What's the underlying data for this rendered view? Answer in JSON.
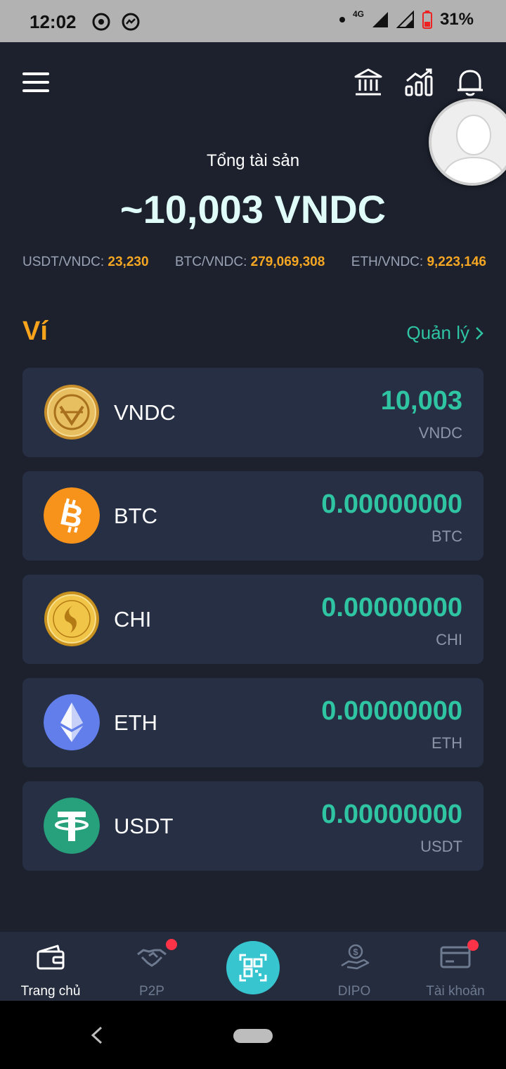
{
  "status_bar": {
    "time": "12:02",
    "network": "4G",
    "battery": "31%"
  },
  "header": {
    "menu_icon": "menu-icon",
    "bank_icon": "bank-icon",
    "chart_icon": "chart-growth-icon",
    "bell_icon": "bell-icon"
  },
  "summary": {
    "label": "Tổng tài sản",
    "total": "~10,003 VNDC"
  },
  "rates": [
    {
      "label": "USDT/VNDC:",
      "value": "23,230"
    },
    {
      "label": "BTC/VNDC:",
      "value": "279,069,308"
    },
    {
      "label": "ETH/VNDC:",
      "value": "9,223,146"
    }
  ],
  "wallet": {
    "title": "Ví",
    "manage_label": "Quản lý",
    "items": [
      {
        "name": "VNDC",
        "amount": "10,003",
        "unit": "VNDC",
        "color": "#d9a441"
      },
      {
        "name": "BTC",
        "amount": "0.00000000",
        "unit": "BTC",
        "color": "#f7931a"
      },
      {
        "name": "CHI",
        "amount": "0.00000000",
        "unit": "CHI",
        "color": "#e0b23c"
      },
      {
        "name": "ETH",
        "amount": "0.00000000",
        "unit": "ETH",
        "color": "#627eea"
      },
      {
        "name": "USDT",
        "amount": "0.00000000",
        "unit": "USDT",
        "color": "#26a17b"
      }
    ]
  },
  "bottom_nav": {
    "home": "Trang chủ",
    "p2p": "P2P",
    "dipo": "DIPO",
    "account": "Tài khoản"
  },
  "colors": {
    "background": "#1c212d",
    "card": "#262f44",
    "accent_green": "#2fc4a2",
    "accent_orange": "#f7a31c"
  }
}
